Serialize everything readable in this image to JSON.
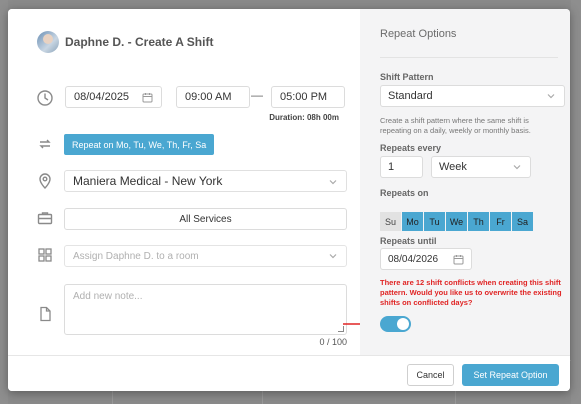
{
  "header": {
    "title": "Daphne D. - Create A Shift"
  },
  "shift": {
    "date": "08/04/2025",
    "start_time": "09:00 AM",
    "time_separator": "—",
    "end_time": "05:00 PM",
    "duration": "Duration: 08h 00m",
    "repeat_label": "Repeat on Mo, Tu, We, Th, Fr, Sa",
    "location": "Maniera Medical - New York",
    "service": "All Services",
    "room_placeholder": "Assign Daphne D. to a room",
    "note_placeholder": "Add new note...",
    "note_count": "0 / 100"
  },
  "repeat_options": {
    "title": "Repeat Options",
    "pattern_label": "Shift Pattern",
    "pattern_value": "Standard",
    "pattern_help": "Create a shift pattern where the same shift is repeating on a daily, weekly or monthly basis.",
    "repeats_every_label": "Repeats every",
    "repeats_every_value": "1",
    "repeats_every_unit": "Week",
    "repeats_on_label": "Repeats on",
    "days": [
      {
        "label": "Su",
        "selected": false
      },
      {
        "label": "Mo",
        "selected": true
      },
      {
        "label": "Tu",
        "selected": true
      },
      {
        "label": "We",
        "selected": true
      },
      {
        "label": "Th",
        "selected": true
      },
      {
        "label": "Fr",
        "selected": true
      },
      {
        "label": "Sa",
        "selected": true
      }
    ],
    "repeats_until_label": "Repeats until",
    "repeats_until_value": "08/04/2026",
    "conflict_message": "There are 12 shift conflicts when creating this shift pattern. Would you like us to overwrite the existing shifts on conflicted days?",
    "overwrite_toggle_on": true
  },
  "footer": {
    "cancel_label": "Cancel",
    "confirm_label": "Set Repeat Option"
  },
  "colors": {
    "accent": "#4aa7d1",
    "warning": "#e02525"
  },
  "icons": [
    "clock-icon",
    "repeat-icon",
    "location-pin-icon",
    "briefcase-icon",
    "grid-icon",
    "file-icon",
    "calendar-icon",
    "chevron-down-icon",
    "arrow-right-icon"
  ]
}
